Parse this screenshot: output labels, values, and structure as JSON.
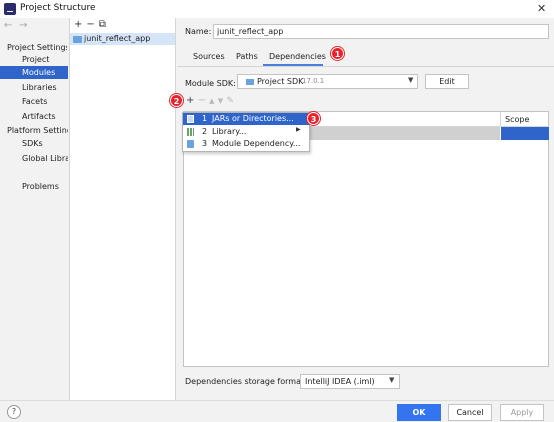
{
  "window": {
    "title": "Project Structure",
    "close_glyph": "✕"
  },
  "nav": {
    "back": "←",
    "forward": "→"
  },
  "sidebar": {
    "sections": [
      {
        "header": "Project Settings",
        "items": [
          "Project",
          "Modules",
          "Libraries",
          "Facets",
          "Artifacts"
        ]
      },
      {
        "header": "Platform Settings",
        "items": [
          "SDKs",
          "Global Libraries"
        ]
      }
    ],
    "problems": "Problems",
    "selected": "Modules"
  },
  "modules": {
    "toolbar": {
      "add": "+",
      "remove": "−",
      "copy": "⧉"
    },
    "items": [
      "junit_reflect_app"
    ]
  },
  "module": {
    "name_label": "Name:",
    "name_value": "junit_reflect_app",
    "tabs": [
      "Sources",
      "Paths",
      "Dependencies"
    ],
    "active_tab": "Dependencies",
    "sdk_label": "Module SDK:",
    "sdk_value": "Project SDK",
    "sdk_version": "17.0.1",
    "sdk_arrow": "▼",
    "edit_label": "Edit",
    "table_header_scope": "Scope",
    "storage_label": "Dependencies storage format:",
    "storage_value": "IntelliJ IDEA (.iml)",
    "storage_arrow": "▼"
  },
  "dep_toolbar": {
    "add": "+",
    "remove": "−",
    "up": "▲",
    "down": "▼",
    "edit": "✎"
  },
  "popup_menu": {
    "items": [
      {
        "number": "1",
        "label": "JARs or Directories...",
        "icon": "jar-icon"
      },
      {
        "number": "2",
        "label": "Library...",
        "icon": "library-icon",
        "submenu_arrow": "▶"
      },
      {
        "number": "3",
        "label": "Module Dependency...",
        "icon": "module-icon"
      }
    ]
  },
  "annotations": {
    "badge1": "1",
    "badge2": "2",
    "badge3": "3",
    "color": "#e8222b"
  },
  "buttons": {
    "help": "?",
    "ok": "OK",
    "cancel": "Cancel",
    "apply": "Apply"
  },
  "colors": {
    "accent": "#2f65ca",
    "ok_button": "#3574f0"
  }
}
